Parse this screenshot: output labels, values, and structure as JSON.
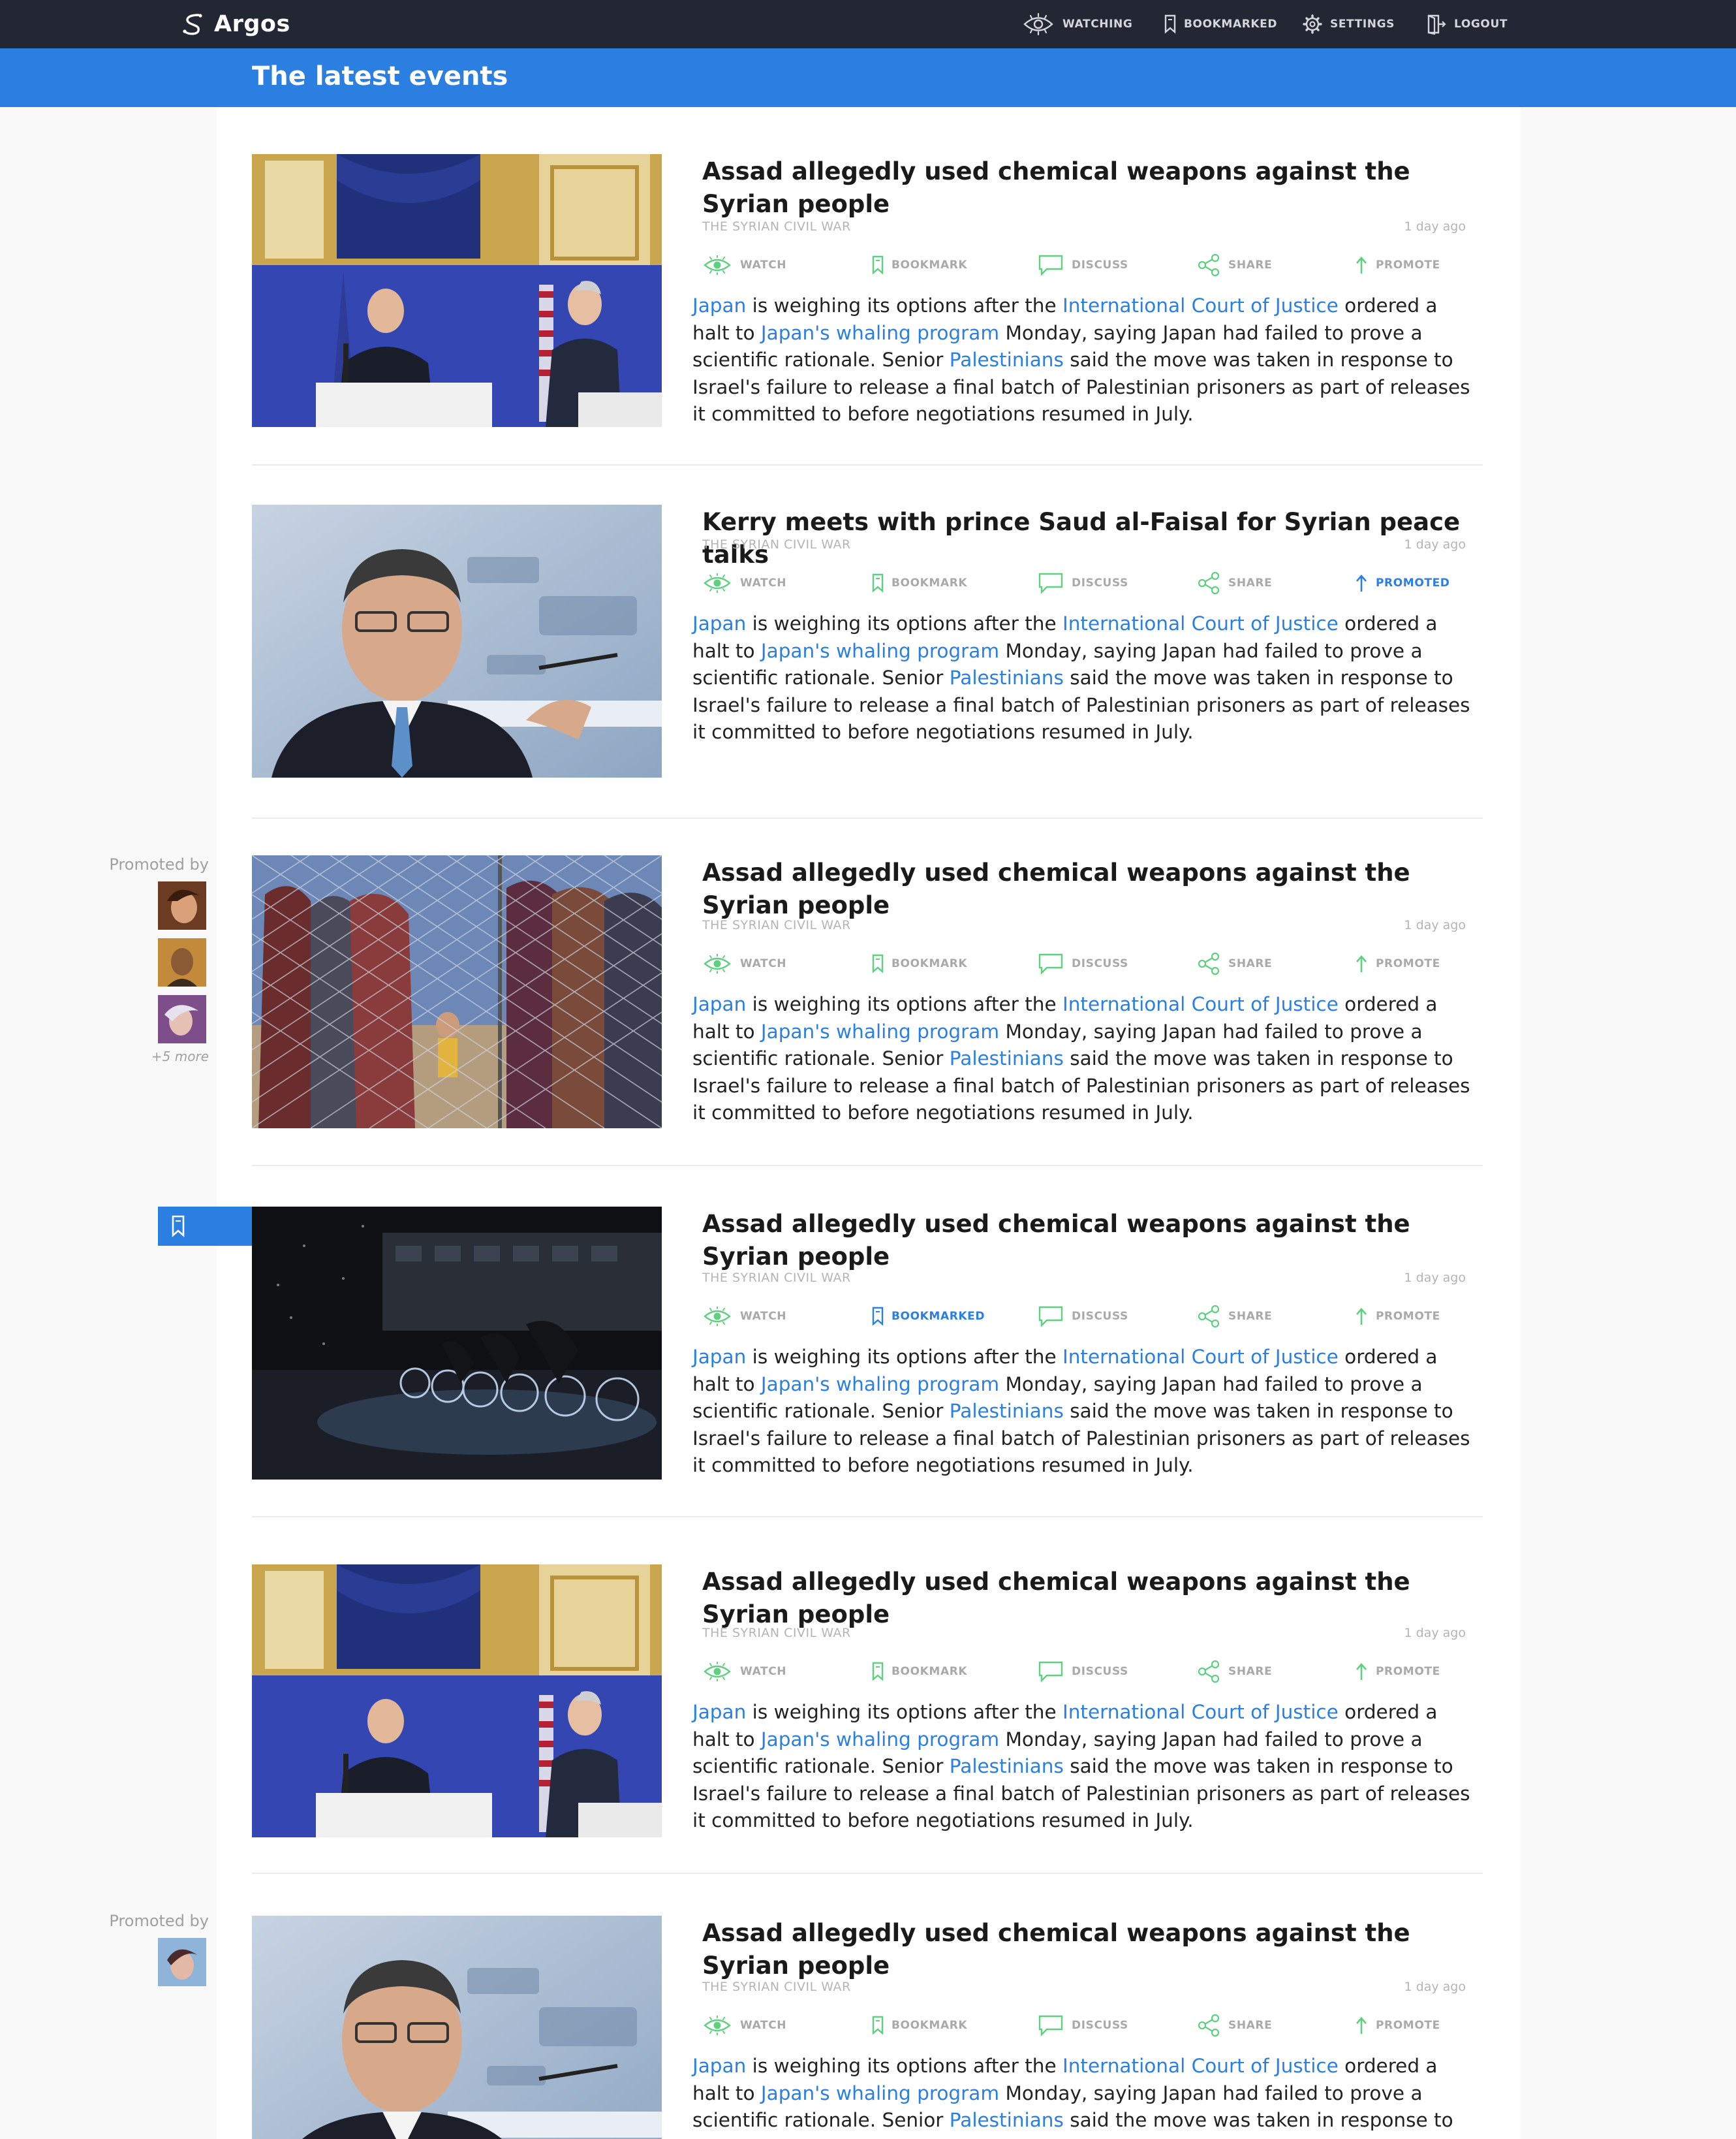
{
  "app": {
    "name": "Argos"
  },
  "nav": {
    "watching": "WATCHING",
    "bookmarked": "BOOKMARKED",
    "settings": "SETTINGS",
    "logout": "LOGOUT"
  },
  "page": {
    "title": "The latest events"
  },
  "colors": {
    "accent": "#2b7fe1",
    "nav_bg": "#222733",
    "action_green": "#5fcf80"
  },
  "promoted_by_label": "Promoted by",
  "promoted_more": "+5 more",
  "articles": [
    {
      "title": "Assad allegedly used chemical weapons against the Syrian people",
      "topic": "THE SYRIAN CIVIL WAR",
      "time": "1 day ago",
      "image": "press-conference-photo",
      "actions": {
        "watch": "WATCH",
        "bookmark": "BOOKMARK",
        "discuss": "DISCUSS",
        "share": "SHARE",
        "promote": "PROMOTE"
      },
      "body": {
        "l1": "Japan",
        "t1": " is weighing its options after the ",
        "l2": "International Court of Justice",
        "t2": " ordered a halt to ",
        "l3": "Japan's whaling program",
        "t3": " Monday, saying Japan had failed to prove a scientific rationale. Senior ",
        "l4": "Palestinians",
        "t4": " said the move was taken in response to Israel's failure to release a final batch of Palestinian prisoners as part of releases it committed to before negotia­tions resumed in July."
      }
    },
    {
      "title": "Kerry meets with prince Saud al-Faisal for Syrian peace talks",
      "topic": "THE SYRIAN CIVIL WAR",
      "time": "1 day ago",
      "image": "speaker-at-conference-photo",
      "actions": {
        "watch": "WATCH",
        "bookmark": "BOOKMARK",
        "discuss": "DISCUSS",
        "share": "SHARE",
        "promote": "PROMOTED"
      },
      "body": {
        "l1": "Japan",
        "t1": " is weighing its options after the ",
        "l2": "International Court of Justice",
        "t2": " ordered a halt to ",
        "l3": "Japan's whaling program",
        "t3": " Monday, saying Japan had failed to prove a scientific rationale. Senior ",
        "l4": "Palestinians",
        "t4": " said the move was taken in response to Israel's failure to release a final batch of Palestinian prisoners as part of releases it committed to before negotia­tions resumed in July."
      }
    },
    {
      "title": "Assad allegedly used chemical weapons against the Syrian people",
      "topic": "THE SYRIAN CIVIL WAR",
      "time": "1 day ago",
      "image": "refugees-behind-fence-photo",
      "actions": {
        "watch": "WATCH",
        "bookmark": "BOOKMARK",
        "discuss": "DISCUSS",
        "share": "SHARE",
        "promote": "PROMOTE"
      },
      "body": {
        "l1": "Japan",
        "t1": " is weighing its options after the ",
        "l2": "International Court of Justice",
        "t2": " ordered a halt to ",
        "l3": "Japan's whaling program",
        "t3": " Monday, saying Japan had failed to prove a scientific rationale. Senior ",
        "l4": "Palestinians",
        "t4": " said the move was taken in response to Israel's failure to release a final batch of Palestinian prisoners as part of releases it committed to before negotia­tions resumed in July."
      }
    },
    {
      "title": "Assad allegedly used chemical weapons against the Syrian people",
      "topic": "THE SYRIAN CIVIL WAR",
      "time": "1 day ago",
      "image": "cyclists-at-night-photo",
      "actions": {
        "watch": "WATCH",
        "bookmark": "BOOKMARKED",
        "discuss": "DISCUSS",
        "share": "SHARE",
        "promote": "PROMOTE"
      },
      "body": {
        "l1": "Japan",
        "t1": " is weighing its options after the ",
        "l2": "International Court of Justice",
        "t2": " ordered a halt to ",
        "l3": "Japan's whaling program",
        "t3": " Monday, saying Japan had failed to prove a scientific rationale. Senior ",
        "l4": "Palestinians",
        "t4": " said the move was taken in response to Israel's failure to release a final batch of Palestinian prisoners as part of releases it committed to before negotia­tions resumed in July."
      }
    },
    {
      "title": "Assad allegedly used chemical weapons against the Syrian people",
      "topic": "THE SYRIAN CIVIL WAR",
      "time": "1 day ago",
      "image": "press-conference-photo",
      "actions": {
        "watch": "WATCH",
        "bookmark": "BOOKMARK",
        "discuss": "DISCUSS",
        "share": "SHARE",
        "promote": "PROMOTE"
      },
      "body": {
        "l1": "Japan",
        "t1": " is weighing its options after the ",
        "l2": "International Court of Justice",
        "t2": " ordered a halt to ",
        "l3": "Japan's whaling program",
        "t3": " Monday, saying Japan had failed to prove a scientific rationale. Senior ",
        "l4": "Palestinians",
        "t4": " said the move was taken in response to Israel's failure to release a final batch of Palestinian prisoners as part of releases it committed to before negotia­tions resumed in July."
      }
    },
    {
      "title": "Assad allegedly used chemical weapons against the Syrian people",
      "topic": "THE SYRIAN CIVIL WAR",
      "time": "1 day ago",
      "image": "speaker-at-conference-photo",
      "actions": {
        "watch": "WATCH",
        "bookmark": "BOOKMARK",
        "discuss": "DISCUSS",
        "share": "SHARE",
        "promote": "PROMOTE"
      },
      "body": {
        "l1": "Japan",
        "t1": " is weighing its options after the ",
        "l2": "International Court of Justice",
        "t2": " ordered a halt to ",
        "l3": "Japan's whaling program",
        "t3": " Monday, saying Japan had failed to prove a scientific rationale. Senior ",
        "l4": "Palestinians",
        "t4": " said the move was taken in response to Israel's failure to release a"
      }
    }
  ]
}
